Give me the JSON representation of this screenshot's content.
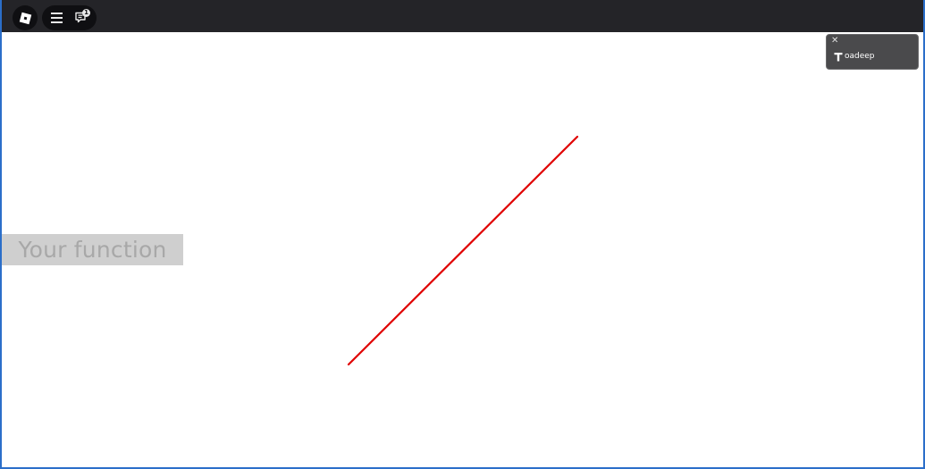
{
  "topbar": {
    "logo_icon": "roblox-logo-icon",
    "menu_icon": "hamburger-menu-icon",
    "chat_icon": "chat-icon",
    "chat_badge": "1"
  },
  "canvas": {
    "function_label": "Your function",
    "line_color": "#e00000",
    "label_bg": "#cfcfcf",
    "label_text_color": "#a8a8a8"
  },
  "toast": {
    "close_label": "✕",
    "icon": "t-letter-icon",
    "username": "oadeep"
  },
  "colors": {
    "topbar_bg": "#242428",
    "window_border": "#2b6ec9",
    "toast_bg": "#4a4a4c"
  }
}
